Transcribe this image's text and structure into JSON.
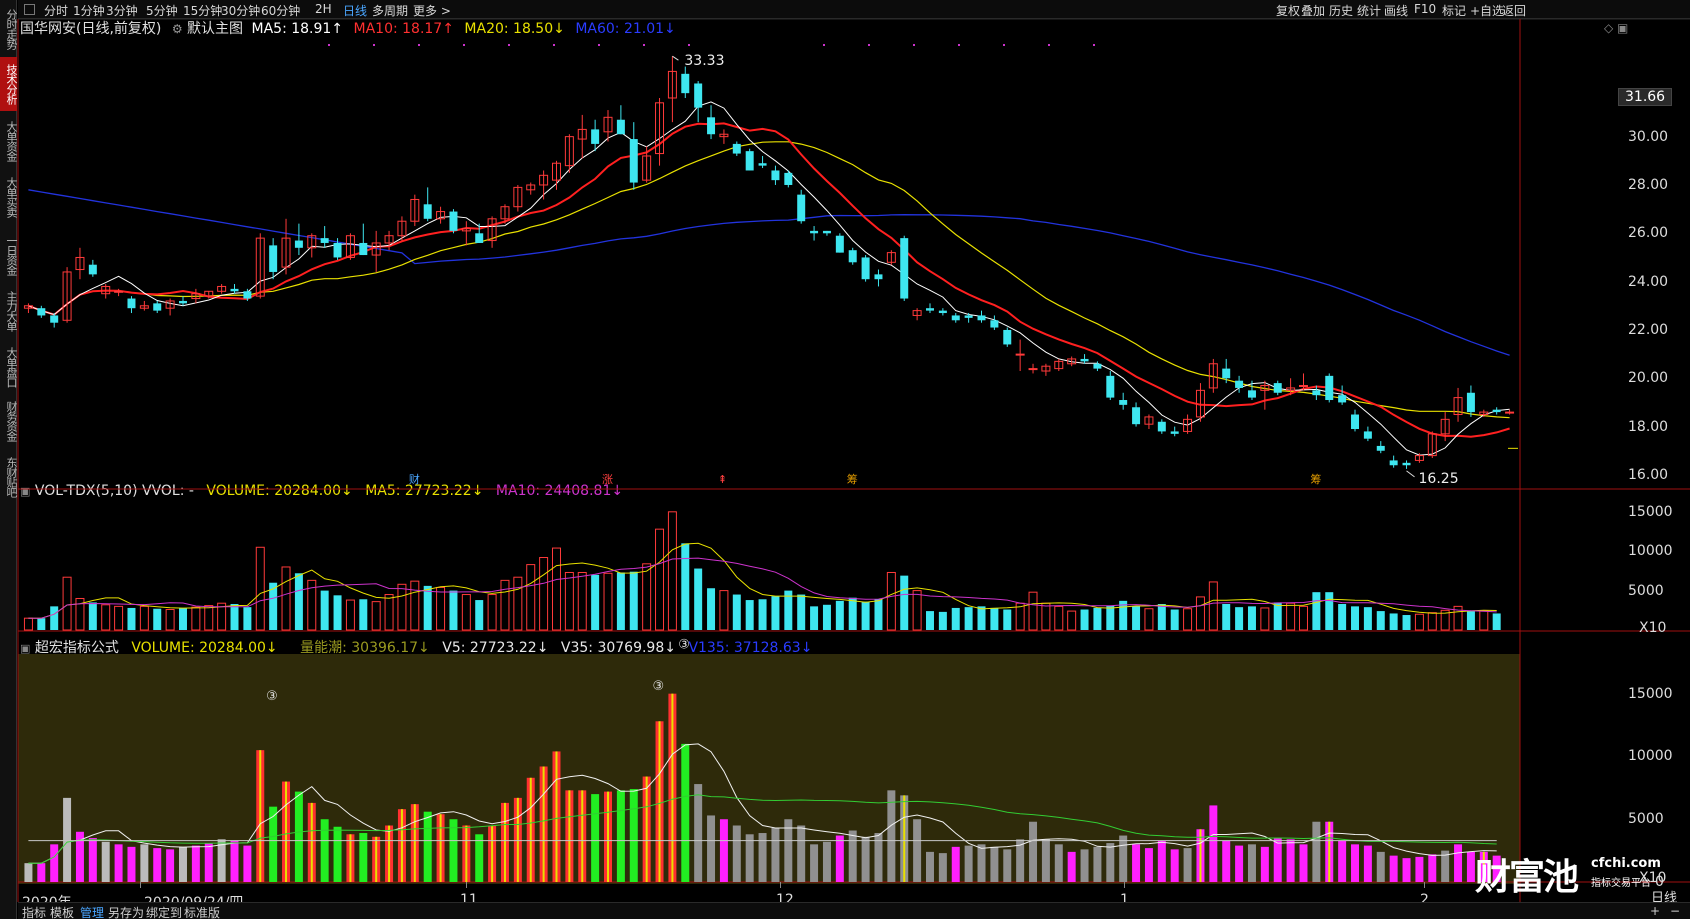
{
  "sidebar": {
    "items": [
      {
        "label": "分时走势",
        "active": false
      },
      {
        "label": "技术分析",
        "active": true
      },
      {
        "label": "大单资金",
        "active": false
      },
      {
        "label": "大单买卖",
        "active": false
      },
      {
        "label": "一日资金",
        "active": false
      },
      {
        "label": "主力大单",
        "active": false
      },
      {
        "label": "大单盘口",
        "active": false
      },
      {
        "label": "财务资金",
        "active": false
      },
      {
        "label": "东财贴吧",
        "active": false
      }
    ]
  },
  "toolbar": {
    "periods": [
      "分时",
      "1分钟",
      "3分钟",
      "5分钟",
      "15分钟",
      "30分钟",
      "60分钟",
      "2H",
      "日线",
      "多周期",
      "更多 >"
    ],
    "active_period": "日线",
    "right_items": [
      "复权",
      "叠加",
      "历史",
      "统计",
      "画线",
      "F10",
      "标记",
      "+自选",
      "返回"
    ]
  },
  "main_legend": {
    "title": "国华网安(日线,前复权)",
    "template": "默认主图",
    "ma5": "MA5: 18.91↑",
    "ma10": "MA10: 18.17↑",
    "ma20": "MA20: 18.50↓",
    "ma60": "MA60: 21.01↓",
    "corner_icons": "◇ ▣"
  },
  "vol_legend": {
    "name": "VOL-TDX(5,10) VVOL: -",
    "volume": "VOLUME: 20284.00↓",
    "ma5": "MA5: 27723.22↓",
    "ma10": "MA10: 24408.81↓"
  },
  "ind_legend": {
    "name": "超宏指标公式",
    "volume": "VOLUME: 20284.00↓",
    "liang": "量能潮: 30396.17↓",
    "v5": "V5: 27723.22↓",
    "v35": "V35: 30769.98↓",
    "v135": "V135: 37128.63↓"
  },
  "price_axis": {
    "current": "31.66",
    "ticks": [
      "30.00",
      "28.00",
      "26.00",
      "24.00",
      "22.00",
      "20.00",
      "18.00",
      "16.00"
    ]
  },
  "vol_axis": {
    "ticks": [
      "15000",
      "10000",
      "5000"
    ],
    "unit": "X10"
  },
  "ind_axis": {
    "ticks": [
      "15000",
      "10000",
      "5000",
      "0"
    ],
    "unit": "X10"
  },
  "time_axis": {
    "labels": [
      "2020年",
      "2020/09/24/四",
      "11",
      "12",
      "1",
      "2"
    ],
    "right_label": "日线"
  },
  "annotations": {
    "high": "33.33",
    "low": "16.25",
    "circle_marks": [
      "③",
      "③",
      "③"
    ],
    "event_marks": [
      "财",
      "涨",
      "⇞",
      "筹",
      "筹"
    ]
  },
  "bottom_bar": {
    "items": [
      "指标",
      "模板",
      "管理",
      "另存为",
      "绑定到",
      "标准版"
    ],
    "active": "管理",
    "right_controls": [
      "+",
      "−"
    ]
  },
  "watermark": {
    "brand": "财富池",
    "url": "cfchi.com",
    "sub": "指标交易平台"
  },
  "colors": {
    "up": "#ff3a3a",
    "down": "#3ee6f0",
    "ma5": "#ffffff",
    "ma10": "#ff2020",
    "ma20": "#e8e000",
    "ma60": "#2233dd",
    "vma10": "#cc33cc",
    "ind_bg": "#2e2a0a",
    "magenta": "#ff20ff",
    "green": "#22ee22",
    "gray": "#909090"
  },
  "chart_data": {
    "type": "candlestick",
    "title": "国华网安(日线,前复权)",
    "ylim": [
      15.5,
      34.0
    ],
    "x_labels": [
      "2020年",
      "2020/09/24/四",
      "11",
      "12",
      "1",
      "2"
    ],
    "candles": [
      [
        22.9,
        23.1,
        22.7,
        23.0
      ],
      [
        22.9,
        23.0,
        22.5,
        22.6
      ],
      [
        22.6,
        22.7,
        22.1,
        22.3
      ],
      [
        22.4,
        24.6,
        22.3,
        24.4
      ],
      [
        24.5,
        25.4,
        24.1,
        25.0
      ],
      [
        24.7,
        24.9,
        24.2,
        24.3
      ],
      [
        23.5,
        23.9,
        23.3,
        23.8
      ],
      [
        23.6,
        23.7,
        23.4,
        23.6
      ],
      [
        23.3,
        23.4,
        22.7,
        22.9
      ],
      [
        22.9,
        23.2,
        22.8,
        23.0
      ],
      [
        23.1,
        23.2,
        22.7,
        22.8
      ],
      [
        22.9,
        23.3,
        22.6,
        23.2
      ],
      [
        23.2,
        23.4,
        23.0,
        23.1
      ],
      [
        23.3,
        23.7,
        23.1,
        23.5
      ],
      [
        23.4,
        23.6,
        23.3,
        23.6
      ],
      [
        23.6,
        23.9,
        23.5,
        23.8
      ],
      [
        23.7,
        23.9,
        23.5,
        23.6
      ],
      [
        23.6,
        23.7,
        23.2,
        23.3
      ],
      [
        23.4,
        26.0,
        23.3,
        25.8
      ],
      [
        25.5,
        25.8,
        24.1,
        24.4
      ],
      [
        24.6,
        26.6,
        24.3,
        25.8
      ],
      [
        25.7,
        26.4,
        25.1,
        25.4
      ],
      [
        25.4,
        26.0,
        25.0,
        25.9
      ],
      [
        25.8,
        26.3,
        25.4,
        25.6
      ],
      [
        25.6,
        25.8,
        24.9,
        25.0
      ],
      [
        25.0,
        26.0,
        24.9,
        25.9
      ],
      [
        25.6,
        26.4,
        25.1,
        25.1
      ],
      [
        25.1,
        26.1,
        24.4,
        25.6
      ],
      [
        25.6,
        26.1,
        25.3,
        25.9
      ],
      [
        25.9,
        26.7,
        25.7,
        26.5
      ],
      [
        26.5,
        27.6,
        26.3,
        27.4
      ],
      [
        27.2,
        27.9,
        26.5,
        26.6
      ],
      [
        26.6,
        27.1,
        26.4,
        26.9
      ],
      [
        26.9,
        27.0,
        26.0,
        26.1
      ],
      [
        26.1,
        26.5,
        25.5,
        26.2
      ],
      [
        26.0,
        26.4,
        25.6,
        25.6
      ],
      [
        25.7,
        26.7,
        25.4,
        26.6
      ],
      [
        26.6,
        27.2,
        26.4,
        27.1
      ],
      [
        27.1,
        28.0,
        26.9,
        27.9
      ],
      [
        27.8,
        28.1,
        27.6,
        28.0
      ],
      [
        28.0,
        28.6,
        27.4,
        28.4
      ],
      [
        28.2,
        29.0,
        27.8,
        28.9
      ],
      [
        28.8,
        30.1,
        28.5,
        30.0
      ],
      [
        29.9,
        30.9,
        29.1,
        30.3
      ],
      [
        30.3,
        30.7,
        29.4,
        29.7
      ],
      [
        30.2,
        31.1,
        29.8,
        30.8
      ],
      [
        30.7,
        31.3,
        30.1,
        30.1
      ],
      [
        29.9,
        30.6,
        27.8,
        28.1
      ],
      [
        28.2,
        29.6,
        28.1,
        29.2
      ],
      [
        29.3,
        31.6,
        28.8,
        31.4
      ],
      [
        31.6,
        33.33,
        30.6,
        32.7
      ],
      [
        32.6,
        32.9,
        31.6,
        31.8
      ],
      [
        32.2,
        32.3,
        30.6,
        31.2
      ],
      [
        30.8,
        31.3,
        29.9,
        30.1
      ],
      [
        30.0,
        30.3,
        29.7,
        30.1
      ],
      [
        29.7,
        29.8,
        29.2,
        29.3
      ],
      [
        29.4,
        29.5,
        28.6,
        28.6
      ],
      [
        28.9,
        29.2,
        28.7,
        28.8
      ],
      [
        28.6,
        28.8,
        28.0,
        28.2
      ],
      [
        28.5,
        28.6,
        27.9,
        28.0
      ],
      [
        27.6,
        27.8,
        26.4,
        26.5
      ],
      [
        26.1,
        26.3,
        25.7,
        26.0
      ],
      [
        26.1,
        26.1,
        25.9,
        26.0
      ],
      [
        25.9,
        26.0,
        25.2,
        25.2
      ],
      [
        25.3,
        25.4,
        24.7,
        24.8
      ],
      [
        25.0,
        25.1,
        24.0,
        24.1
      ],
      [
        24.3,
        24.5,
        23.8,
        24.1
      ],
      [
        24.8,
        25.3,
        24.7,
        25.2
      ],
      [
        25.8,
        25.9,
        23.2,
        23.3
      ],
      [
        22.6,
        22.9,
        22.4,
        22.8
      ],
      [
        22.9,
        23.1,
        22.7,
        22.8
      ],
      [
        22.8,
        22.9,
        22.6,
        22.7
      ],
      [
        22.6,
        22.7,
        22.3,
        22.4
      ],
      [
        22.6,
        22.7,
        22.3,
        22.5
      ],
      [
        22.6,
        22.8,
        22.3,
        22.4
      ],
      [
        22.4,
        22.6,
        22.0,
        22.1
      ],
      [
        22.0,
        22.1,
        21.3,
        21.4
      ],
      [
        21.0,
        21.6,
        20.3,
        21.0
      ],
      [
        20.4,
        20.6,
        20.2,
        20.4
      ],
      [
        20.3,
        20.6,
        20.1,
        20.5
      ],
      [
        20.4,
        20.8,
        20.3,
        20.7
      ],
      [
        20.6,
        20.9,
        20.5,
        20.8
      ],
      [
        20.8,
        21.0,
        20.6,
        20.7
      ],
      [
        20.6,
        20.7,
        20.3,
        20.4
      ],
      [
        20.1,
        20.3,
        19.1,
        19.2
      ],
      [
        19.1,
        19.4,
        18.7,
        18.9
      ],
      [
        18.8,
        19.0,
        18.0,
        18.1
      ],
      [
        18.1,
        18.5,
        17.9,
        18.4
      ],
      [
        18.2,
        18.3,
        17.7,
        17.8
      ],
      [
        17.8,
        18.0,
        17.6,
        17.7
      ],
      [
        17.8,
        18.5,
        17.7,
        18.3
      ],
      [
        18.4,
        19.8,
        18.2,
        19.5
      ],
      [
        19.6,
        20.8,
        19.4,
        20.6
      ],
      [
        20.4,
        20.8,
        19.8,
        20.0
      ],
      [
        19.9,
        20.1,
        19.4,
        19.6
      ],
      [
        19.5,
        19.9,
        19.1,
        19.2
      ],
      [
        19.5,
        19.9,
        18.7,
        19.7
      ],
      [
        19.8,
        19.9,
        19.3,
        19.4
      ],
      [
        19.5,
        20.0,
        19.3,
        19.6
      ],
      [
        19.7,
        20.2,
        19.5,
        19.7
      ],
      [
        19.5,
        19.7,
        19.1,
        19.3
      ],
      [
        20.1,
        20.2,
        19.0,
        19.1
      ],
      [
        19.3,
        19.7,
        18.9,
        19.0
      ],
      [
        18.5,
        18.7,
        17.8,
        17.9
      ],
      [
        17.8,
        18.0,
        17.4,
        17.5
      ],
      [
        17.2,
        17.4,
        16.9,
        17.0
      ],
      [
        16.6,
        16.8,
        16.3,
        16.4
      ],
      [
        16.5,
        16.6,
        16.25,
        16.4
      ],
      [
        16.6,
        16.9,
        16.5,
        16.8
      ],
      [
        16.8,
        17.8,
        16.7,
        17.7
      ],
      [
        17.7,
        18.6,
        17.4,
        18.3
      ],
      [
        18.5,
        19.6,
        18.2,
        19.2
      ],
      [
        19.4,
        19.7,
        18.4,
        18.6
      ],
      [
        18.5,
        18.7,
        18.4,
        18.6
      ],
      [
        18.7,
        18.8,
        18.5,
        18.6
      ],
      [
        18.6,
        18.7,
        18.5,
        18.6
      ]
    ],
    "volume": [
      1500,
      1500,
      3000,
      6700,
      4000,
      3500,
      3200,
      3000,
      2800,
      3000,
      2700,
      2600,
      2800,
      2900,
      3100,
      3400,
      3300,
      2900,
      10500,
      6000,
      8000,
      7200,
      6300,
      5000,
      4400,
      3800,
      3900,
      3600,
      4500,
      5800,
      6200,
      5600,
      5400,
      5000,
      4500,
      3800,
      4500,
      6300,
      6700,
      8300,
      9200,
      10400,
      7300,
      7300,
      7000,
      7200,
      7300,
      7400,
      8400,
      12800,
      15000,
      11000,
      7800,
      5300,
      5000,
      4500,
      3800,
      3900,
      4300,
      5000,
      4500,
      3000,
      3200,
      3700,
      4100,
      3600,
      3900,
      7300,
      6900,
      5000,
      2400,
      2300,
      2800,
      2900,
      3000,
      2800,
      2600,
      3400,
      4800,
      3400,
      3000,
      2400,
      2600,
      2800,
      3100,
      3700,
      3000,
      2700,
      3300,
      2600,
      2700,
      4200,
      6100,
      3300,
      2900,
      3000,
      2800,
      3500,
      3400,
      3000,
      4800,
      4800,
      3300,
      3000,
      2900,
      2400,
      2100,
      1900,
      2000,
      2200,
      2500,
      3000,
      2400,
      2400,
      2100
    ]
  }
}
